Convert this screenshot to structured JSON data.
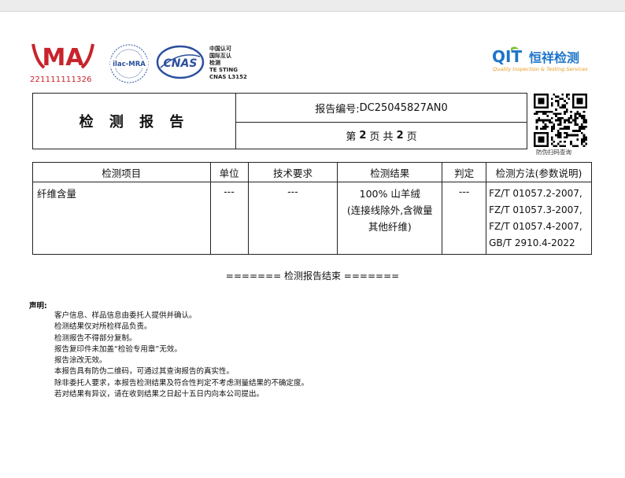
{
  "logos": {
    "ma_text": "MA",
    "ma_number": "221111111326",
    "ilac_text": "ilac-MRA",
    "cnas_text": "CNAS",
    "cnas_side_lines": [
      "中国认可",
      "国际互认",
      "检测",
      "TE STING",
      "CNAS L3152"
    ],
    "qit_text": "QIT",
    "company_cn": "恒祥检测",
    "company_en": "Quality Inspection & Testing Services"
  },
  "colors": {
    "ma_red": "#c8232c",
    "cnas_blue": "#2c4f9e",
    "qit_blue": "#1e74c8",
    "qit_green": "#7cc242",
    "qit_orange": "#e89a1e"
  },
  "header": {
    "title": "检 测 报 告",
    "report_no_label": "报告编号:",
    "report_no": "DC25045827AN0",
    "page_prefix": "第",
    "page_current": "2",
    "page_mid": "页 共",
    "page_total": "2",
    "page_suffix": "页",
    "qr_caption": "防伪扫码查询"
  },
  "table": {
    "headers": [
      "检测项目",
      "单位",
      "技术要求",
      "检测结果",
      "判定",
      "检测方法(参数说明)"
    ],
    "row": {
      "item": "纤维含量",
      "unit": "---",
      "requirement": "---",
      "result_line1": "100% 山羊绒",
      "result_line2": "(连接线除外,含微量",
      "result_line3": "其他纤维)",
      "judgement": "---",
      "methods": [
        "FZ/T 01057.2-2007,",
        "FZ/T 01057.3-2007,",
        "FZ/T 01057.4-2007,",
        "GB/T 2910.4-2022"
      ]
    }
  },
  "end_text": "======= 检测报告结束 =======",
  "statement": {
    "title": "声明:",
    "items": [
      "客户信息、样品信息由委托人提供并确认。",
      "检测结果仅对所检样品负责。",
      "检测报告不得部分复制。",
      "报告复印件未加盖“检验专用章”无效。",
      "报告涂改无效。",
      "本报告具有防伪二维码，可通过其查询报告的真实性。",
      "除非委托人要求，本报告检测结果及符合性判定不考虑测量结果的不确定度。",
      "若对结果有异议，请在收到结果之日起十五日内向本公司提出。"
    ]
  }
}
